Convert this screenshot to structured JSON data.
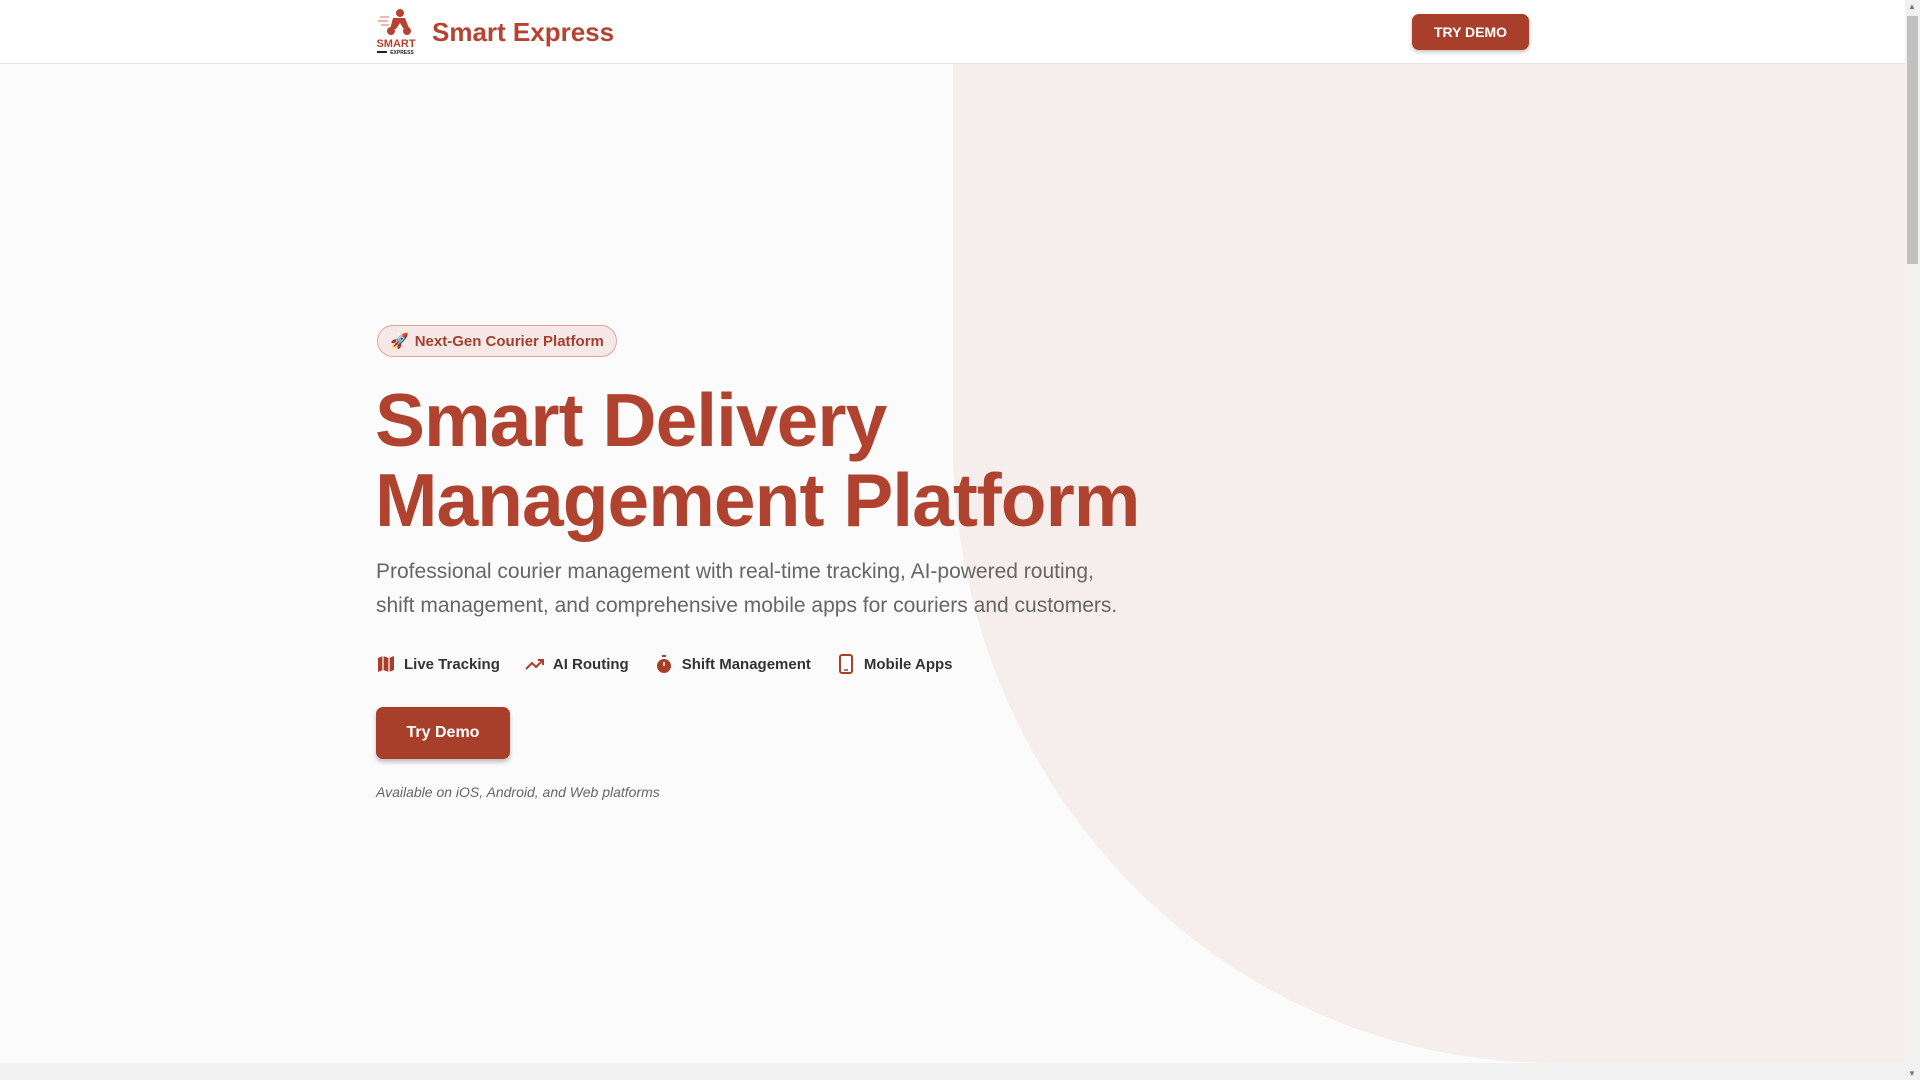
{
  "nav": {
    "brand": "Smart Express",
    "logo_text": "SMART EXPRESS",
    "try_demo": "TRY DEMO"
  },
  "hero": {
    "badge": "Next-Gen Courier Platform",
    "title_line1": "Smart Delivery",
    "title_line2": "Management Platform",
    "lead": "Professional courier management with real-time tracking, AI-powered routing, shift management, and comprehensive mobile apps for couriers and customers.",
    "features": [
      {
        "label": "Live Tracking",
        "icon": "map-icon"
      },
      {
        "label": "AI Routing",
        "icon": "trending-up-icon"
      },
      {
        "label": "Shift Management",
        "icon": "stopwatch-icon"
      },
      {
        "label": "Mobile Apps",
        "icon": "smartphone-icon"
      }
    ],
    "cta": "Try Demo",
    "availability": "Available on iOS, Android, and Web platforms"
  },
  "colors": {
    "brand": "#a83f2b",
    "heading": "#b0432f"
  }
}
